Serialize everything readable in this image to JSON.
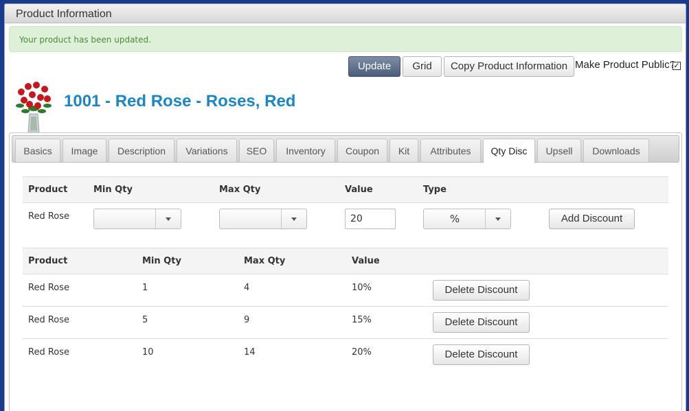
{
  "window": {
    "title": "Product Information"
  },
  "alert": {
    "message": "Your product has been updated."
  },
  "toolbar": {
    "update_label": "Update",
    "grid_label": "Grid",
    "copy_label": "Copy Product Information",
    "public_label": "Make Product Public?",
    "public_checked": true
  },
  "product": {
    "title": "1001 - Red Rose - Roses, Red",
    "image_icon": "rose-bouquet-icon"
  },
  "tabs": [
    {
      "label": "Basics"
    },
    {
      "label": "Image"
    },
    {
      "label": "Description"
    },
    {
      "label": "Variations"
    },
    {
      "label": "SEO"
    },
    {
      "label": "Inventory"
    },
    {
      "label": "Coupon"
    },
    {
      "label": "Kit"
    },
    {
      "label": "Attributes"
    },
    {
      "label": "Qty Disc",
      "active": true
    },
    {
      "label": "Upsell"
    },
    {
      "label": "Downloads"
    }
  ],
  "add_form": {
    "headers": [
      "Product",
      "Min Qty",
      "Max Qty",
      "Value",
      "Type"
    ],
    "product": "Red Rose",
    "min_qty": "",
    "max_qty": "",
    "value": "20",
    "type": "%",
    "add_label": "Add Discount"
  },
  "discounts": {
    "headers": [
      "Product",
      "Min Qty",
      "Max Qty",
      "Value"
    ],
    "delete_label": "Delete Discount",
    "rows": [
      {
        "product": "Red Rose",
        "min": "1",
        "max": "4",
        "value": "10%"
      },
      {
        "product": "Red Rose",
        "min": "5",
        "max": "9",
        "value": "15%"
      },
      {
        "product": "Red Rose",
        "min": "10",
        "max": "14",
        "value": "20%"
      }
    ]
  },
  "colors": {
    "accent": "#1a86c8",
    "success_bg": "#dff0d8",
    "success_text": "#4a8a3a",
    "desktop_bg": "#1a3a8c"
  }
}
